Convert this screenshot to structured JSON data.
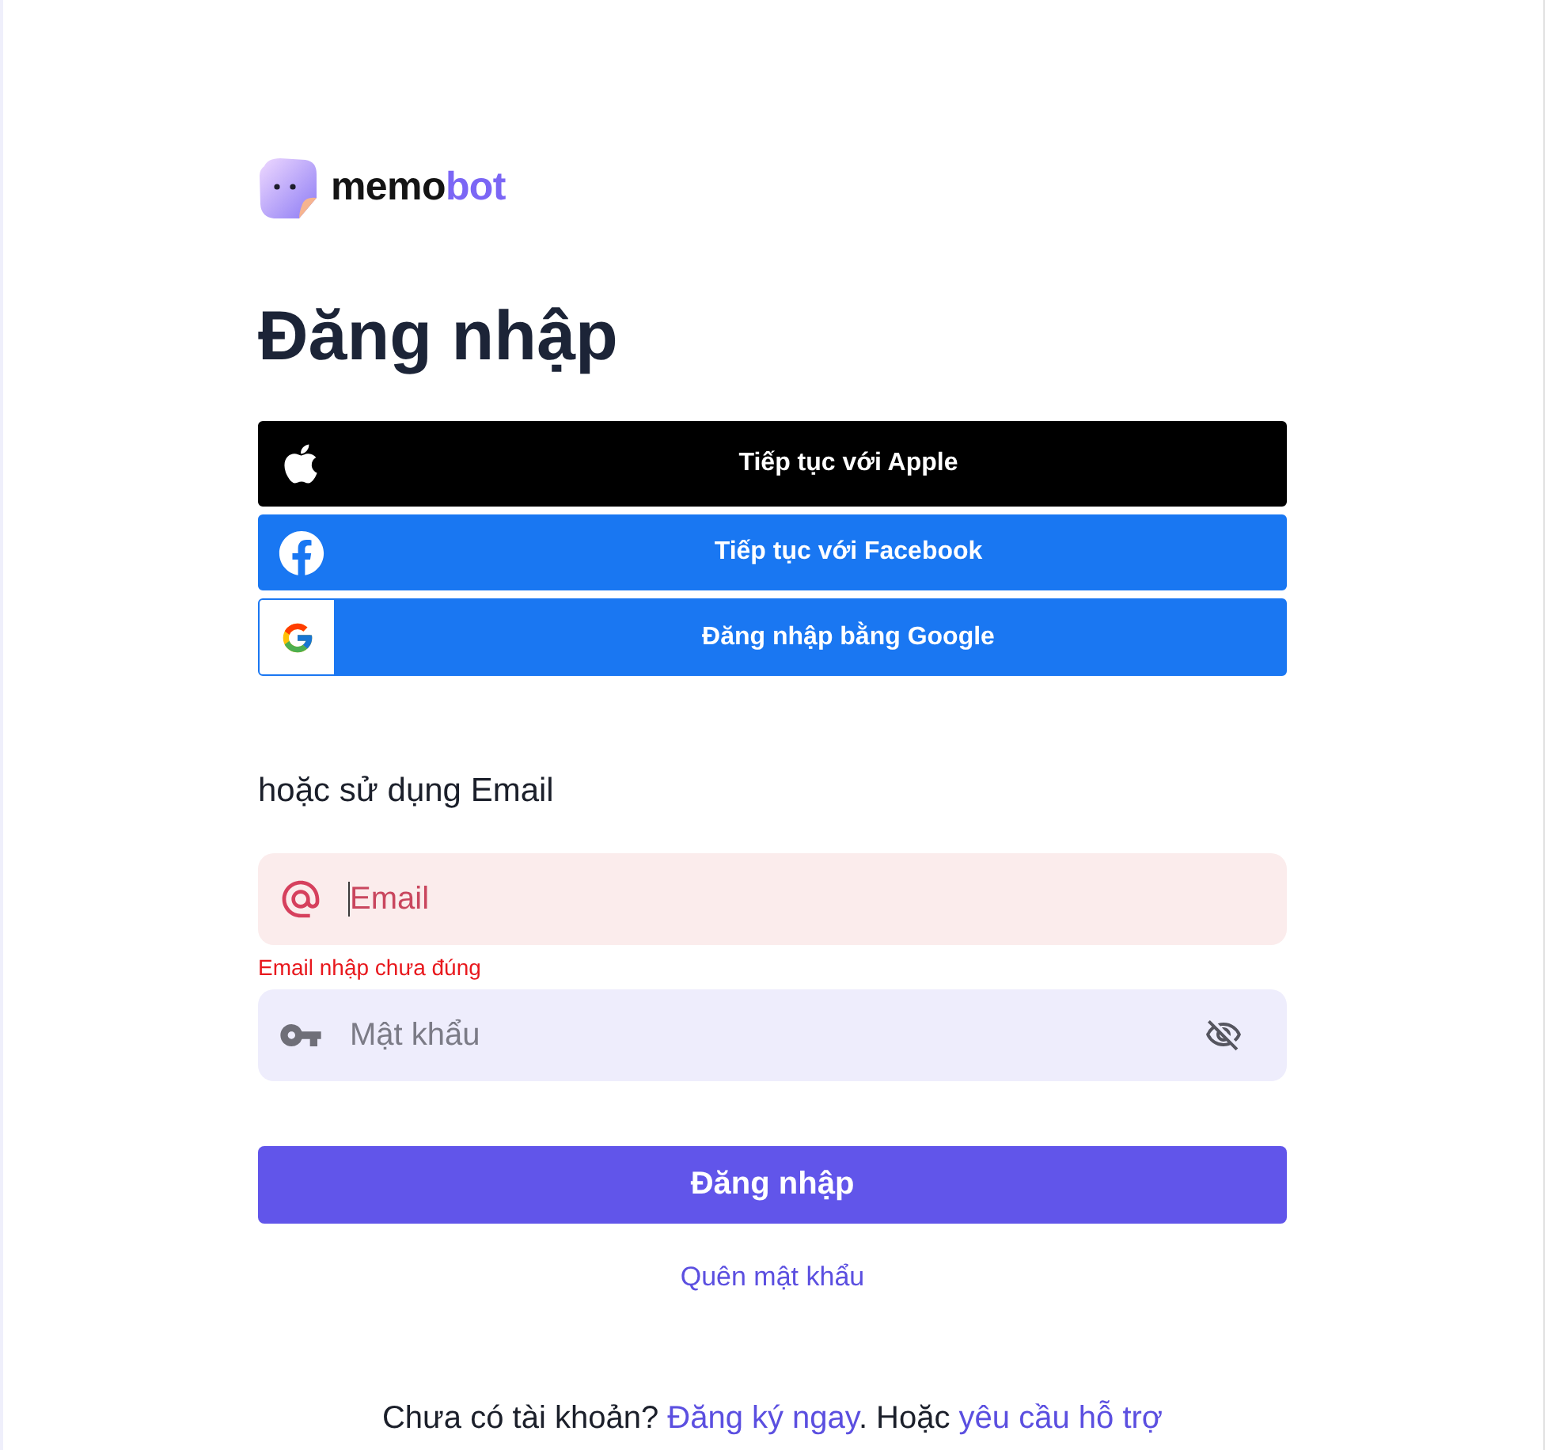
{
  "logo": {
    "text": "memo",
    "accent_text": "bot"
  },
  "heading": "Đăng nhập",
  "social_buttons": [
    {
      "kind": "apple",
      "label": "Tiếp tục với Apple"
    },
    {
      "kind": "facebook",
      "label": "Tiếp tục với Facebook"
    },
    {
      "kind": "google",
      "label": "Đăng nhập bằng Google"
    }
  ],
  "email_section_label": "hoặc sử dụng Email",
  "email_field": {
    "placeholder": "Email",
    "invalid": true,
    "focused": true,
    "error": "Email nhập chưa đúng"
  },
  "password_field": {
    "placeholder": "Mật khẩu",
    "invalid": false,
    "password_visible": false
  },
  "submit_button": {
    "label": "Đăng nhập"
  },
  "forgot_password_link": "Quên mật khẩu",
  "signup_prompt": [
    {
      "kind": "text",
      "text": "Chưa có tài khoản? "
    },
    {
      "kind": "link",
      "text": "Đăng ký ngay"
    },
    {
      "kind": "text",
      "text": ". Hoặc "
    },
    {
      "kind": "link",
      "text": "yêu cầu hỗ trợ"
    }
  ]
}
